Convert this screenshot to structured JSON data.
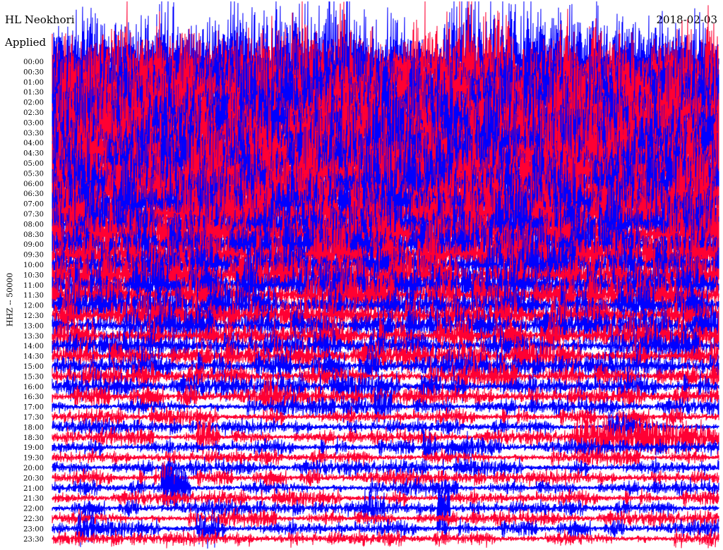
{
  "header": {
    "title": "HL Neokhori",
    "filter": "Applied",
    "date": "2018-02-03"
  },
  "chart_data": {
    "type": "line",
    "ylabel": "HHZ -- 50000",
    "row_labels": [
      "00:00",
      "00:30",
      "01:00",
      "01:30",
      "02:00",
      "02:30",
      "03:00",
      "03:30",
      "04:00",
      "04:30",
      "05:00",
      "05:30",
      "06:00",
      "06:30",
      "07:00",
      "07:30",
      "08:00",
      "08:30",
      "09:00",
      "09:30",
      "10:00",
      "10:30",
      "11:00",
      "11:30",
      "12:00",
      "12:30",
      "13:00",
      "13:30",
      "14:00",
      "14:30",
      "15:00",
      "15:30",
      "16:00",
      "16:30",
      "17:00",
      "17:30",
      "18:00",
      "18:30",
      "19:00",
      "19:30",
      "20:00",
      "20:30",
      "21:00",
      "21:30",
      "22:00",
      "22:30",
      "23:00",
      "23:30"
    ],
    "row_colors": [
      "#0000ff",
      "#ff0033"
    ],
    "noise_level": [
      1.0,
      1.0,
      1.0,
      1.0,
      1.0,
      1.0,
      1.0,
      1.0,
      0.95,
      0.92,
      0.9,
      0.88,
      0.85,
      0.8,
      0.75,
      0.7,
      0.65,
      0.6,
      0.55,
      0.5,
      0.47,
      0.45,
      0.42,
      0.38,
      0.34,
      0.3,
      0.27,
      0.25,
      0.23,
      0.21,
      0.19,
      0.17,
      0.15,
      0.12,
      0.08,
      0.065,
      0.06,
      0.055,
      0.06,
      0.06,
      0.065,
      0.06,
      0.06,
      0.055,
      0.06,
      0.06,
      0.065,
      0.06
    ],
    "events": [
      {
        "row": "18:30",
        "start_minute": 6.5,
        "end_minute": 7.5,
        "strength": 0.6
      },
      {
        "row": "18:30",
        "start_minute": 23.5,
        "end_minute": 30.0,
        "strength": 0.55
      },
      {
        "row": "18:00",
        "start_minute": 25.0,
        "end_minute": 26.5,
        "strength": 0.4
      },
      {
        "row": "17:00",
        "start_minute": 13.0,
        "end_minute": 14.2,
        "strength": 0.45
      },
      {
        "row": "17:00",
        "start_minute": 14.5,
        "end_minute": 15.3,
        "strength": 0.6
      },
      {
        "row": "21:00",
        "start_minute": 4.9,
        "end_minute": 6.2,
        "strength": 0.9
      },
      {
        "row": "20:30",
        "start_minute": 4.9,
        "end_minute": 5.7,
        "strength": 0.5
      },
      {
        "row": "23:00",
        "start_minute": 1.1,
        "end_minute": 1.9,
        "strength": 0.6
      },
      {
        "row": "23:00",
        "start_minute": 6.5,
        "end_minute": 7.5,
        "strength": 0.5
      },
      {
        "row": "22:00",
        "start_minute": 14.0,
        "end_minute": 15.0,
        "strength": 0.45
      },
      {
        "row": "22:00",
        "start_minute": 17.3,
        "end_minute": 17.9,
        "strength": 0.95
      },
      {
        "row": "19:00",
        "start_minute": 16.7,
        "end_minute": 17.3,
        "strength": 0.6
      },
      {
        "row": "19:00",
        "start_minute": 18.5,
        "end_minute": 19.5,
        "strength": 0.4
      },
      {
        "row": "16:30",
        "start_minute": 9.5,
        "end_minute": 10.2,
        "strength": 0.6
      },
      {
        "row": "16:00",
        "start_minute": 16.5,
        "end_minute": 17.5,
        "strength": 0.5
      }
    ]
  }
}
